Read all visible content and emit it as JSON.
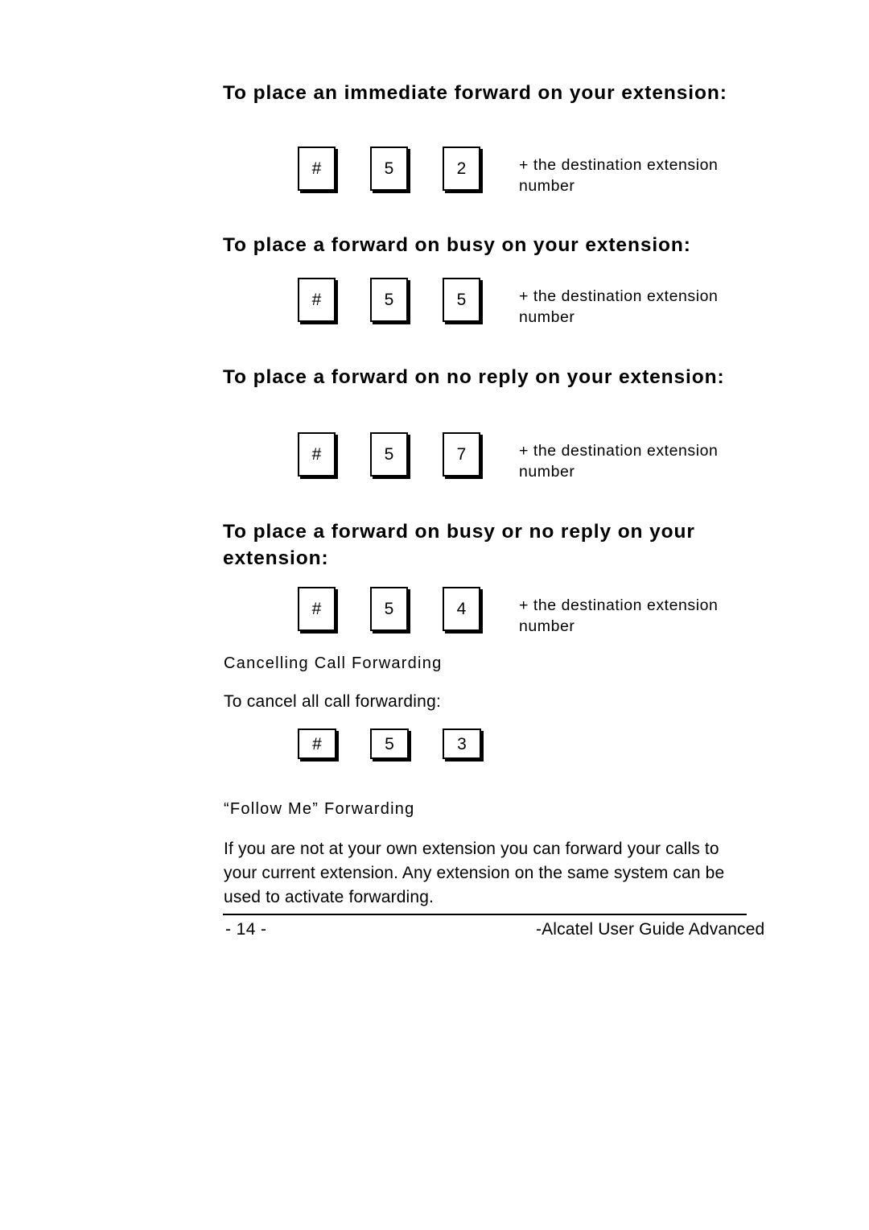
{
  "document": {
    "page_number_label": "- 14 -",
    "footer_title": "-Alcatel User Guide Advanced"
  },
  "sections": [
    {
      "heading": "To place an immediate forward on your extension:",
      "keys": [
        "#",
        "5",
        "2"
      ],
      "note": "+ the destination extension number"
    },
    {
      "heading": "To place a forward on busy on your extension:",
      "keys": [
        "#",
        "5",
        "5"
      ],
      "note": "+ the destination extension number"
    },
    {
      "heading": "To place a forward on no reply on your extension:",
      "keys": [
        "#",
        "5",
        "7"
      ],
      "note": "+ the destination extension number"
    },
    {
      "heading": "To place a forward on busy or no reply on your extension:",
      "keys": [
        "#",
        "5",
        "4"
      ],
      "note": "+ the destination extension number"
    }
  ],
  "cancelling": {
    "subheading": "Cancelling Call Forwarding",
    "instruction": "To cancel all call forwarding:",
    "keys": [
      "#",
      "5",
      "3"
    ]
  },
  "follow_me": {
    "subheading": "“Follow Me” Forwarding",
    "paragraph": "If you are not at your own extension you can forward your calls to your current extension.  Any extension on the same system can be used to activate forwarding."
  },
  "colors": {
    "text": "#000000",
    "background": "#ffffff",
    "key_border": "#000000"
  }
}
